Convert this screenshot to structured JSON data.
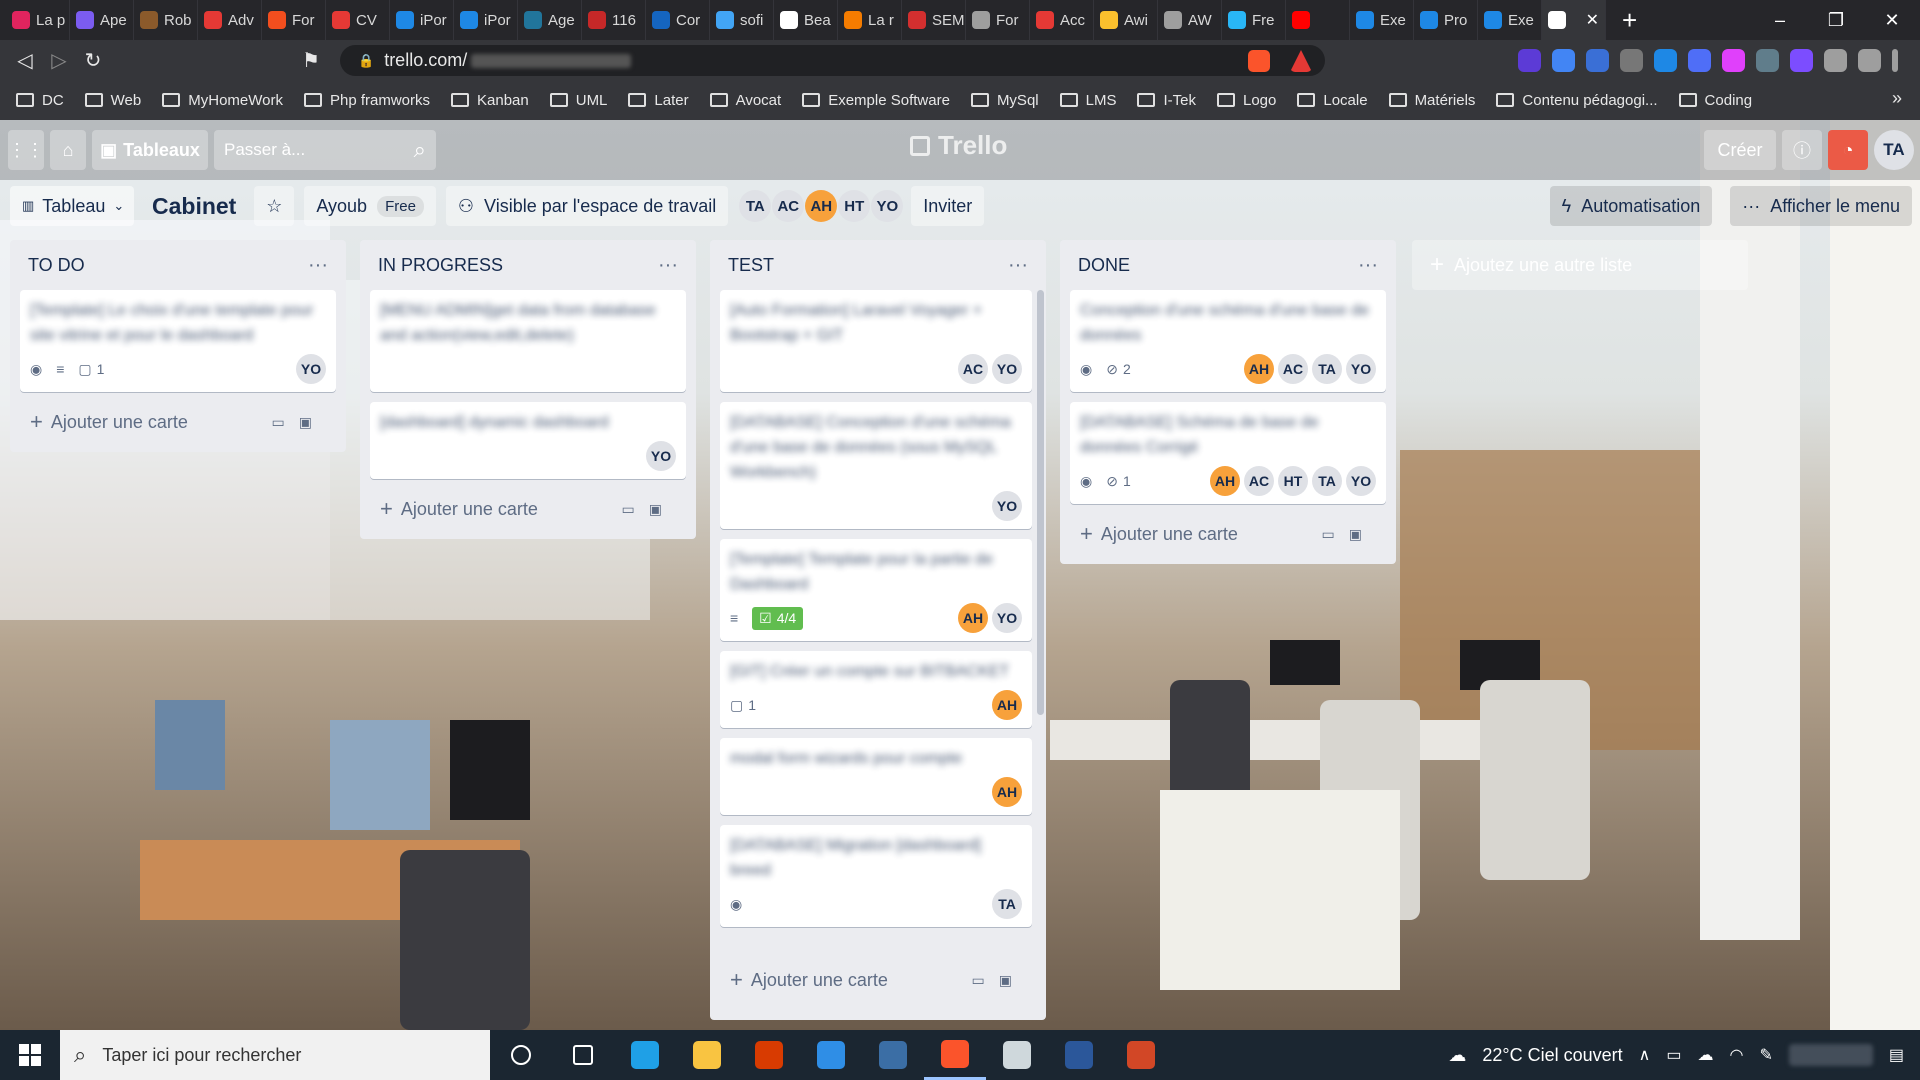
{
  "browser": {
    "tabs": [
      {
        "title": "La p",
        "color": "#e0245e"
      },
      {
        "title": "Ape",
        "color": "#7b5cf0"
      },
      {
        "title": "Rob",
        "color": "#8b5a2b"
      },
      {
        "title": "Adv",
        "color": "#e53935"
      },
      {
        "title": "For",
        "color": "#f24e1e"
      },
      {
        "title": "CV",
        "color": "#e53935"
      },
      {
        "title": "iPor",
        "color": "#1e88e5"
      },
      {
        "title": "iPor",
        "color": "#1e88e5"
      },
      {
        "title": "Age",
        "color": "#21759b"
      },
      {
        "title": "116",
        "color": "#c62828"
      },
      {
        "title": "Cor",
        "color": "#1565c0"
      },
      {
        "title": "sofi",
        "color": "#42a5f5"
      },
      {
        "title": "Bea",
        "color": "#ffffff"
      },
      {
        "title": "La r",
        "color": "#f57c00"
      },
      {
        "title": "SEM",
        "color": "#d32f2f"
      },
      {
        "title": "For",
        "color": "#9e9e9e"
      },
      {
        "title": "Acc",
        "color": "#e53935"
      },
      {
        "title": "Awi",
        "color": "#fbc02d"
      },
      {
        "title": "AW",
        "color": "#9e9e9e"
      },
      {
        "title": "Fre",
        "color": "#29b6f6"
      },
      {
        "title": "",
        "color": "#ff0000"
      },
      {
        "title": "Exe",
        "color": "#1e88e5"
      },
      {
        "title": "Pro",
        "color": "#1e88e5"
      },
      {
        "title": "Exe",
        "color": "#1e88e5"
      },
      {
        "title": "",
        "color": "#ffffff"
      }
    ],
    "url": "trello.com/",
    "bookmarks": [
      "DC",
      "Web",
      "MyHomeWork",
      "Php framworks",
      "Kanban",
      "UML",
      "Later",
      "Avocat",
      "Exemple Software",
      "MySql",
      "LMS",
      "I-Tek",
      "Logo",
      "Locale",
      "Matériels",
      "Contenu pédagogi...",
      "Coding"
    ],
    "bookmarks_more": "»",
    "new_tab": "+"
  },
  "trello": {
    "header": {
      "boards_label": "Tableaux",
      "search_placeholder": "Passer à...",
      "logo": "Trello",
      "create_label": "Créer",
      "avatar": "TA"
    },
    "board": {
      "view_label": "Tableau",
      "title": "Cabinet",
      "workspace": "Ayoub",
      "workspace_plan": "Free",
      "visibility": "Visible par l'espace de travail",
      "members": [
        {
          "initials": "TA",
          "color": "#dfe1e6"
        },
        {
          "initials": "AC",
          "color": "#dfe1e6"
        },
        {
          "initials": "AH",
          "color": "#f7a13b"
        },
        {
          "initials": "HT",
          "color": "#dfe1e6"
        },
        {
          "initials": "YO",
          "color": "#dfe1e6"
        }
      ],
      "invite_label": "Inviter",
      "automation_label": "Automatisation",
      "menu_label": "Afficher le menu",
      "add_list_label": "Ajoutez une autre liste",
      "add_card_label": "Ajouter une carte"
    },
    "lists": [
      {
        "title": "TO DO",
        "cards": [
          {
            "text": "[Template] Le choix d'une template pour site vitrine et pour le dashboard",
            "watch": true,
            "desc": true,
            "comments": "1",
            "members": [
              "YO"
            ]
          }
        ]
      },
      {
        "title": "IN PROGRESS",
        "cards": [
          {
            "text": "[MENU ADMIN]get data from database and action(view,edit,delete)",
            "members": []
          },
          {
            "text": "[dashboard] dynamic dashboard",
            "members": [
              "YO"
            ]
          }
        ]
      },
      {
        "title": "TEST",
        "cards": [
          {
            "text": "[Auto Formation] Laravel Voyager + Bootstrap + GIT",
            "members": [
              "AC",
              "YO"
            ]
          },
          {
            "text": "[DATABASE] Conception d'une schéma d'une base de données (sous MySQL Workbench)",
            "members": [
              "YO"
            ]
          },
          {
            "text": "[Template] Template pour la partie de Dashboard",
            "desc": true,
            "checklist": "4/4",
            "members": [
              "AH",
              "YO"
            ]
          },
          {
            "text": "[GIT] Créer un compte sur BITBACKET",
            "comments": "1",
            "members": [
              "AH"
            ]
          },
          {
            "text": "modal form wizards pour compte",
            "members": [
              "AH"
            ]
          },
          {
            "text": "[DATABASE] Migration [dashboard] breed",
            "watch": true,
            "members": [
              "TA"
            ]
          }
        ]
      },
      {
        "title": "DONE",
        "cards": [
          {
            "text": "Conception d'une schéma d'une base de données",
            "watch": true,
            "attachments": "2",
            "members": [
              "AH",
              "AC",
              "TA",
              "YO"
            ]
          },
          {
            "text": "[DATABASE] Schéma de base de données Corrigé",
            "watch": true,
            "attachments": "1",
            "members": [
              "AH",
              "AC",
              "HT",
              "TA",
              "YO"
            ]
          }
        ]
      }
    ],
    "orange_members": [
      "AH"
    ]
  },
  "taskbar": {
    "search_placeholder": "Taper ici pour rechercher",
    "apps": [
      {
        "name": "task-view",
        "color": "#ffffff"
      },
      {
        "name": "widgets",
        "color": "#ffffff"
      },
      {
        "name": "edge",
        "color": "#1fa0e6"
      },
      {
        "name": "file-explorer",
        "color": "#f9c441"
      },
      {
        "name": "office",
        "color": "#d83b01"
      },
      {
        "name": "vscode",
        "color": "#2f8ee6"
      },
      {
        "name": "tool",
        "color": "#3b6ea5"
      },
      {
        "name": "brave",
        "color": "#fb542b"
      },
      {
        "name": "paint",
        "color": "#cfd8dc"
      },
      {
        "name": "word",
        "color": "#2b579a"
      },
      {
        "name": "powerpoint",
        "color": "#d24726"
      }
    ],
    "weather": "22°C  Ciel couvert"
  },
  "icons": {
    "lock": "🔒",
    "star": "☆",
    "search": "⌕",
    "plus": "+",
    "dots": "···",
    "bell": "🔔",
    "info": "ⓘ"
  }
}
